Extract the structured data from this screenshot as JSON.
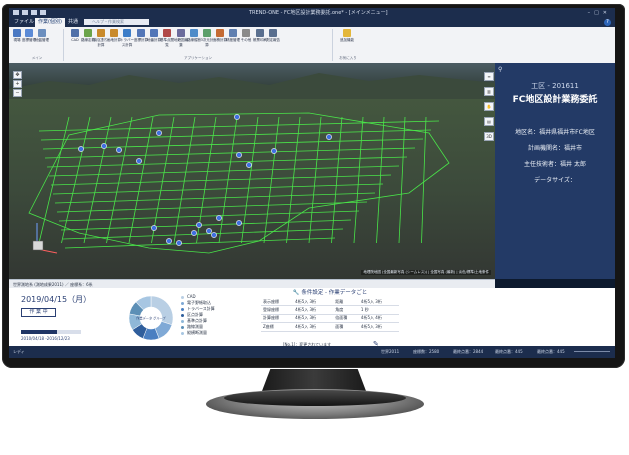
{
  "window": {
    "title": "TREND-ONE - FC地区設計業務委託.one* - [メインメニュー]"
  },
  "ribbon_tabs": [
    "ファイル",
    "作業(個別)",
    "共通"
  ],
  "search": {
    "placeholder": "ヘルプ・作業検索"
  },
  "ribbon": {
    "buttons": [
      {
        "label": "現場",
        "icon": "site-icon",
        "color": "#4a78c2"
      },
      {
        "label": "座標管理",
        "icon": "coordinate-icon",
        "color": "#5b8ad6"
      },
      {
        "label": "地盤管理",
        "icon": "ground-icon",
        "color": "#6c8fbf"
      },
      {
        "label": "CAD",
        "icon": "cad-icon",
        "color": "#4f6fa8"
      },
      {
        "label": "路線定義",
        "icon": "route-icon",
        "color": "#6aa34a"
      },
      {
        "label": "街区割り計算",
        "icon": "block-icon",
        "color": "#c98a2b"
      },
      {
        "label": "画地計算",
        "icon": "lot-icon",
        "color": "#c98a2b"
      },
      {
        "label": "トラバース計算",
        "icon": "traverse-icon",
        "color": "#3d7dc8"
      },
      {
        "label": "座標計算",
        "icon": "calc-icon",
        "color": "#5276b8"
      },
      {
        "label": "地番計算",
        "icon": "parcel-icon",
        "color": "#5276b8"
      },
      {
        "label": "基準点閲覧",
        "icon": "benchmark-icon",
        "color": "#b04848"
      },
      {
        "label": "地籍図編集",
        "icon": "cadastral-icon",
        "color": "#6b6b9c"
      },
      {
        "label": "路線縦断",
        "icon": "profile-icon",
        "color": "#4f8cc9"
      },
      {
        "label": "3次元計算",
        "icon": "3d-icon",
        "color": "#5b9f6a"
      },
      {
        "label": "面積計算",
        "icon": "area-icon",
        "color": "#c46b34"
      },
      {
        "label": "精度管理",
        "icon": "accuracy-icon",
        "color": "#5f7fb0"
      },
      {
        "label": "その他",
        "icon": "other-icon",
        "color": "#8a8a8a"
      },
      {
        "label": "帳票印刷",
        "icon": "print-icon",
        "color": "#5a6f8f"
      },
      {
        "label": "測定報告",
        "icon": "report-icon",
        "color": "#5a6f8f"
      },
      {
        "label": "追加機能",
        "icon": "star-icon",
        "color": "#e4b73a"
      }
    ],
    "groups": {
      "main": "メイン",
      "applications": "アプリケーション",
      "favorites": "お気に入り"
    }
  },
  "map": {
    "attribution": "地理院地図 (全国最新写真 (シームレス)) | 全国写真 (最新) | 淡色/標準/土地条件",
    "status": "世界測地系 (測地成果2011) ／ 座標系：6系"
  },
  "side_panel": {
    "site_code": "工区 - 201611",
    "site_name": "FC地区設計業務委託",
    "location": "地区名：福井県福井市FC地区",
    "organization": "計画機関名：福井市",
    "engineer": "主任技術者：福井 太郎",
    "data_size": "データサイズ："
  },
  "dashboard": {
    "date": "2019/04/15（月）",
    "status": "作 業 中",
    "period": "2010/04/18 -2016/12/23",
    "progress": 0.6,
    "donut_center": "作業データ グループ",
    "legend": [
      {
        "label": "CAD",
        "color": "#b9cfe4"
      },
      {
        "label": "電子野帳取込",
        "color": "#7fa9d6"
      },
      {
        "label": "トラバース計算",
        "color": "#4a7fc1"
      },
      {
        "label": "区点計算",
        "color": "#2f5e9c"
      },
      {
        "label": "基準点計算",
        "color": "#8fb8d8"
      },
      {
        "label": "路線測量",
        "color": "#5c8fb6"
      },
      {
        "label": "縦横断測量",
        "color": "#a7c6e2"
      }
    ],
    "donut_slices": [
      0.3,
      0.14,
      0.12,
      0.1,
      0.12,
      0.1,
      0.12
    ],
    "conditions": {
      "title": "条件設定 - 作業データごと",
      "rows": [
        [
          "表示座標",
          "4桁5入 3桁",
          "距離",
          "4桁5入 3桁"
        ],
        [
          "登録座標",
          "4桁5入 3桁",
          "角度",
          "1 秒"
        ],
        [
          "計算座標",
          "4桁5入 3桁",
          "倍面積",
          "4桁5入 4桁"
        ],
        [
          "Z座標",
          "4桁5入 3桁",
          "面積",
          "4桁5入 3桁"
        ]
      ],
      "footer": "[No.1]：変更されています"
    }
  },
  "status_bar": {
    "ready": "レディ",
    "datum": "世界2011",
    "point_count": "座標数：2580",
    "recent_point": "最終点番：2844",
    "recent_number": "最終点番：445",
    "max_point": "最終点番：445"
  }
}
